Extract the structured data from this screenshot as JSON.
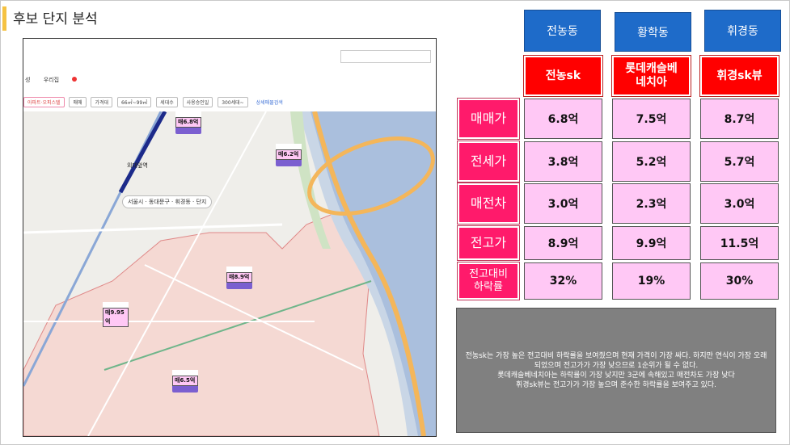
{
  "slide": {
    "title": "후보 단지 분석"
  },
  "map": {
    "tabs": [
      "성",
      "우리집"
    ],
    "filters": [
      "아파트·오피스텔",
      "매매",
      "가격대",
      "66㎡~99㎡",
      "세대수",
      "사용승인일",
      "300세대~",
      "상세매물검색"
    ],
    "location": [
      "서울시",
      "동대문구",
      "휘경동",
      "단지"
    ],
    "station": "외대앞역",
    "price_tags": [
      {
        "label": "매6.8억"
      },
      {
        "label": "매6.2억"
      },
      {
        "label": "매8.9억"
      },
      {
        "label": "매9.95억"
      },
      {
        "label": "매6.5억"
      }
    ]
  },
  "colors": {
    "header": "#1e6bc9",
    "name": "#ff0000",
    "rowlabel": "#ff1a6b",
    "value": "#ffc8f5",
    "summary": "#808080"
  },
  "table": {
    "dongs": [
      "전농동",
      "황학동",
      "휘경동"
    ],
    "complexes": [
      "전농sk",
      "롯데캐슬베네치아",
      "휘경sk뷰"
    ],
    "rows": [
      {
        "label": "매매가",
        "values": [
          "6.8억",
          "7.5억",
          "8.7억"
        ]
      },
      {
        "label": "전세가",
        "values": [
          "3.8억",
          "5.2억",
          "5.7억"
        ]
      },
      {
        "label": "매전차",
        "values": [
          "3.0억",
          "2.3억",
          "3.0억"
        ]
      },
      {
        "label": "전고가",
        "values": [
          "8.9억",
          "9.9억",
          "11.5억"
        ]
      },
      {
        "label": "전고대비 하락률",
        "values": [
          "32%",
          "19%",
          "30%"
        ]
      }
    ]
  },
  "summary": {
    "lines": [
      "전농sk는 가장 높은 전고대비 하락률을 보여줬으며 현재 가격이 가장 싸다. 하지만 연식이 가장 오래되었으며 전고가가 가장 낮으므로 1순위가 될 수 없다.",
      "롯데캐슬베네치아는 하락률이 가장 낮지만 3군에 속해있고 매전차도 가장 낮다",
      "휘경sk뷰는 전고가가 가장 높으며 준수한 하락률을 보여주고 있다."
    ]
  }
}
